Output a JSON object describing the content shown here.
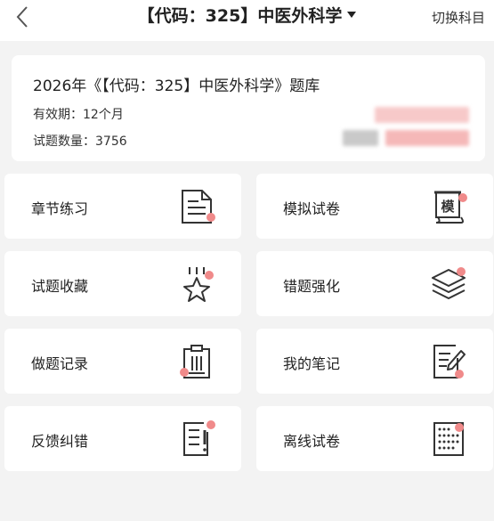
{
  "header": {
    "title": "【代码：325】中医外科学",
    "switch_label": "切换科目"
  },
  "info": {
    "bank_title": "2026年《【代码：325】中医外科学》题库",
    "validity": "有效期：12个月",
    "question_count": "试题数量：3756"
  },
  "menu": {
    "items": [
      {
        "label": "章节练习",
        "icon": "document-icon"
      },
      {
        "label": "模拟试卷",
        "icon": "scroll-exam-icon"
      },
      {
        "label": "试题收藏",
        "icon": "star-icon"
      },
      {
        "label": "错题强化",
        "icon": "layers-icon"
      },
      {
        "label": "做题记录",
        "icon": "clipboard-icon"
      },
      {
        "label": "我的笔记",
        "icon": "notes-pencil-icon"
      },
      {
        "label": "反馈纠错",
        "icon": "feedback-icon"
      },
      {
        "label": "离线试卷",
        "icon": "offline-paper-icon"
      }
    ]
  },
  "colors": {
    "accent_dot": "#f08a8a",
    "background": "#f3f3f3",
    "card": "#ffffff"
  }
}
